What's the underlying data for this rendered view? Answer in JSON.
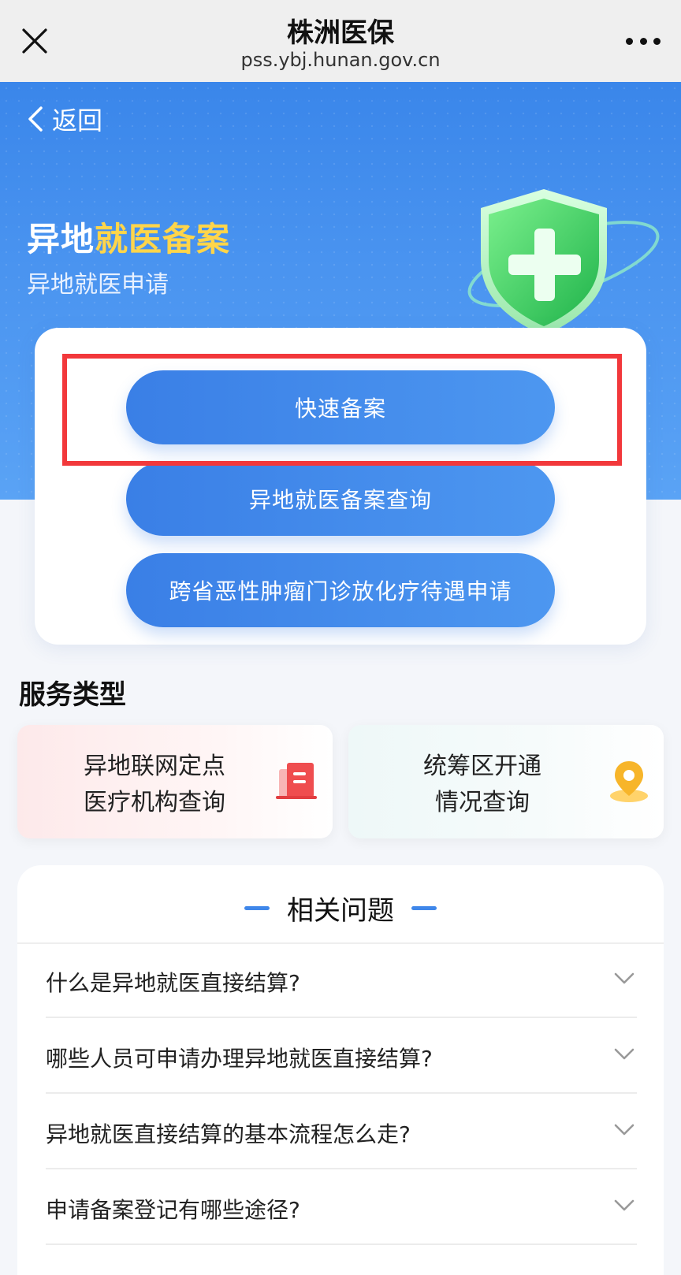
{
  "titlebar": {
    "title": "株洲医保",
    "url": "pss.ybj.hunan.gov.cn"
  },
  "hero": {
    "back_label": "返回",
    "title_prefix": "异地",
    "title_highlight": "就医备案",
    "subtitle": "异地就医申请"
  },
  "actions": {
    "quick_record": "快速备案",
    "record_query": "异地就医备案查询",
    "cancer_treatment": "跨省恶性肿瘤门诊放化疗待遇申请"
  },
  "services": {
    "title": "服务类型",
    "items": [
      {
        "line1": "异地联网定点",
        "line2": "医疗机构查询",
        "icon": "hospital-building-icon"
      },
      {
        "line1": "统筹区开通",
        "line2": "情况查询",
        "icon": "location-pin-icon"
      }
    ]
  },
  "faq": {
    "title": "相关问题",
    "items": [
      "什么是异地就医直接结算?",
      "哪些人员可申请办理异地就医直接结算?",
      "异地就医直接结算的基本流程怎么走?",
      "申请备案登记有哪些途径?"
    ]
  },
  "colors": {
    "primary": "#3a7fe6",
    "highlight": "#ffd54a",
    "annotation": "#f2383b"
  }
}
